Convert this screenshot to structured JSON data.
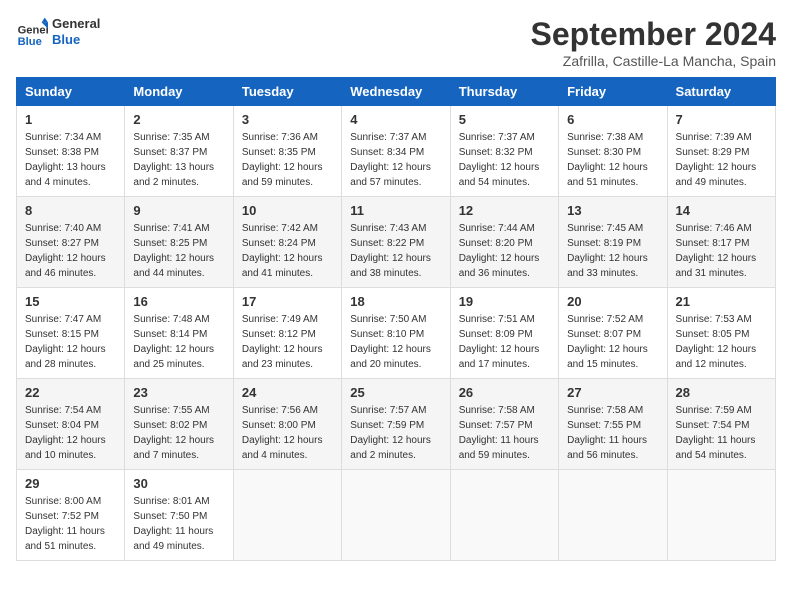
{
  "header": {
    "logo_general": "General",
    "logo_blue": "Blue",
    "title": "September 2024",
    "subtitle": "Zafrilla, Castille-La Mancha, Spain"
  },
  "columns": [
    "Sunday",
    "Monday",
    "Tuesday",
    "Wednesday",
    "Thursday",
    "Friday",
    "Saturday"
  ],
  "weeks": [
    [
      {
        "day": "1",
        "sunrise": "Sunrise: 7:34 AM",
        "sunset": "Sunset: 8:38 PM",
        "daylight": "Daylight: 13 hours and 4 minutes."
      },
      {
        "day": "2",
        "sunrise": "Sunrise: 7:35 AM",
        "sunset": "Sunset: 8:37 PM",
        "daylight": "Daylight: 13 hours and 2 minutes."
      },
      {
        "day": "3",
        "sunrise": "Sunrise: 7:36 AM",
        "sunset": "Sunset: 8:35 PM",
        "daylight": "Daylight: 12 hours and 59 minutes."
      },
      {
        "day": "4",
        "sunrise": "Sunrise: 7:37 AM",
        "sunset": "Sunset: 8:34 PM",
        "daylight": "Daylight: 12 hours and 57 minutes."
      },
      {
        "day": "5",
        "sunrise": "Sunrise: 7:37 AM",
        "sunset": "Sunset: 8:32 PM",
        "daylight": "Daylight: 12 hours and 54 minutes."
      },
      {
        "day": "6",
        "sunrise": "Sunrise: 7:38 AM",
        "sunset": "Sunset: 8:30 PM",
        "daylight": "Daylight: 12 hours and 51 minutes."
      },
      {
        "day": "7",
        "sunrise": "Sunrise: 7:39 AM",
        "sunset": "Sunset: 8:29 PM",
        "daylight": "Daylight: 12 hours and 49 minutes."
      }
    ],
    [
      {
        "day": "8",
        "sunrise": "Sunrise: 7:40 AM",
        "sunset": "Sunset: 8:27 PM",
        "daylight": "Daylight: 12 hours and 46 minutes."
      },
      {
        "day": "9",
        "sunrise": "Sunrise: 7:41 AM",
        "sunset": "Sunset: 8:25 PM",
        "daylight": "Daylight: 12 hours and 44 minutes."
      },
      {
        "day": "10",
        "sunrise": "Sunrise: 7:42 AM",
        "sunset": "Sunset: 8:24 PM",
        "daylight": "Daylight: 12 hours and 41 minutes."
      },
      {
        "day": "11",
        "sunrise": "Sunrise: 7:43 AM",
        "sunset": "Sunset: 8:22 PM",
        "daylight": "Daylight: 12 hours and 38 minutes."
      },
      {
        "day": "12",
        "sunrise": "Sunrise: 7:44 AM",
        "sunset": "Sunset: 8:20 PM",
        "daylight": "Daylight: 12 hours and 36 minutes."
      },
      {
        "day": "13",
        "sunrise": "Sunrise: 7:45 AM",
        "sunset": "Sunset: 8:19 PM",
        "daylight": "Daylight: 12 hours and 33 minutes."
      },
      {
        "day": "14",
        "sunrise": "Sunrise: 7:46 AM",
        "sunset": "Sunset: 8:17 PM",
        "daylight": "Daylight: 12 hours and 31 minutes."
      }
    ],
    [
      {
        "day": "15",
        "sunrise": "Sunrise: 7:47 AM",
        "sunset": "Sunset: 8:15 PM",
        "daylight": "Daylight: 12 hours and 28 minutes."
      },
      {
        "day": "16",
        "sunrise": "Sunrise: 7:48 AM",
        "sunset": "Sunset: 8:14 PM",
        "daylight": "Daylight: 12 hours and 25 minutes."
      },
      {
        "day": "17",
        "sunrise": "Sunrise: 7:49 AM",
        "sunset": "Sunset: 8:12 PM",
        "daylight": "Daylight: 12 hours and 23 minutes."
      },
      {
        "day": "18",
        "sunrise": "Sunrise: 7:50 AM",
        "sunset": "Sunset: 8:10 PM",
        "daylight": "Daylight: 12 hours and 20 minutes."
      },
      {
        "day": "19",
        "sunrise": "Sunrise: 7:51 AM",
        "sunset": "Sunset: 8:09 PM",
        "daylight": "Daylight: 12 hours and 17 minutes."
      },
      {
        "day": "20",
        "sunrise": "Sunrise: 7:52 AM",
        "sunset": "Sunset: 8:07 PM",
        "daylight": "Daylight: 12 hours and 15 minutes."
      },
      {
        "day": "21",
        "sunrise": "Sunrise: 7:53 AM",
        "sunset": "Sunset: 8:05 PM",
        "daylight": "Daylight: 12 hours and 12 minutes."
      }
    ],
    [
      {
        "day": "22",
        "sunrise": "Sunrise: 7:54 AM",
        "sunset": "Sunset: 8:04 PM",
        "daylight": "Daylight: 12 hours and 10 minutes."
      },
      {
        "day": "23",
        "sunrise": "Sunrise: 7:55 AM",
        "sunset": "Sunset: 8:02 PM",
        "daylight": "Daylight: 12 hours and 7 minutes."
      },
      {
        "day": "24",
        "sunrise": "Sunrise: 7:56 AM",
        "sunset": "Sunset: 8:00 PM",
        "daylight": "Daylight: 12 hours and 4 minutes."
      },
      {
        "day": "25",
        "sunrise": "Sunrise: 7:57 AM",
        "sunset": "Sunset: 7:59 PM",
        "daylight": "Daylight: 12 hours and 2 minutes."
      },
      {
        "day": "26",
        "sunrise": "Sunrise: 7:58 AM",
        "sunset": "Sunset: 7:57 PM",
        "daylight": "Daylight: 11 hours and 59 minutes."
      },
      {
        "day": "27",
        "sunrise": "Sunrise: 7:58 AM",
        "sunset": "Sunset: 7:55 PM",
        "daylight": "Daylight: 11 hours and 56 minutes."
      },
      {
        "day": "28",
        "sunrise": "Sunrise: 7:59 AM",
        "sunset": "Sunset: 7:54 PM",
        "daylight": "Daylight: 11 hours and 54 minutes."
      }
    ],
    [
      {
        "day": "29",
        "sunrise": "Sunrise: 8:00 AM",
        "sunset": "Sunset: 7:52 PM",
        "daylight": "Daylight: 11 hours and 51 minutes."
      },
      {
        "day": "30",
        "sunrise": "Sunrise: 8:01 AM",
        "sunset": "Sunset: 7:50 PM",
        "daylight": "Daylight: 11 hours and 49 minutes."
      },
      null,
      null,
      null,
      null,
      null
    ]
  ]
}
